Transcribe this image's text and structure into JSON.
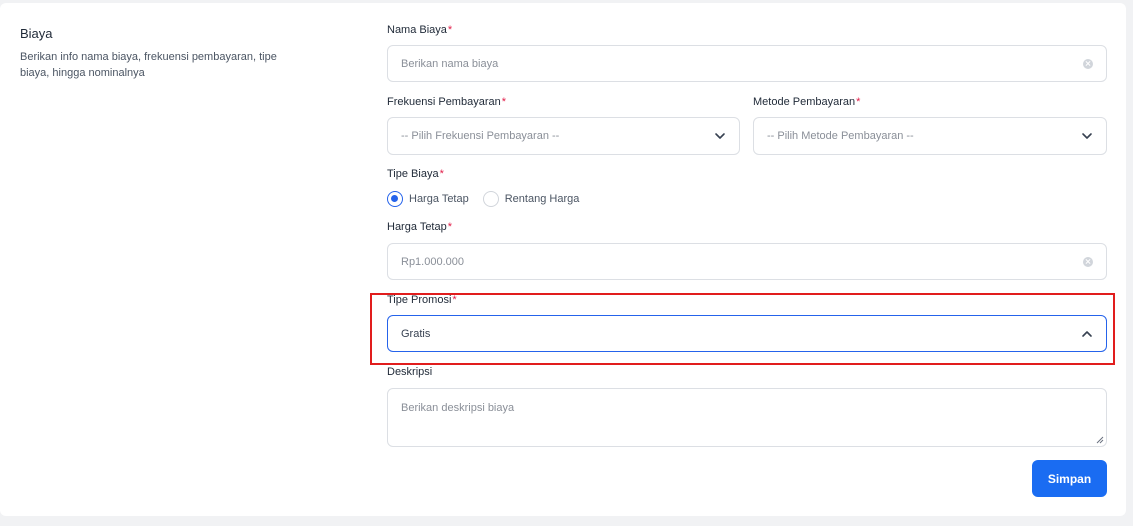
{
  "section": {
    "title": "Biaya",
    "description": "Berikan info nama biaya, frekuensi pembayaran, tipe biaya, hingga nominalnya"
  },
  "form": {
    "required_mark": "*",
    "nama_biaya": {
      "label": "Nama Biaya",
      "placeholder": "Berikan nama biaya"
    },
    "frekuensi": {
      "label": "Frekuensi Pembayaran",
      "value": "-- Pilih Frekuensi Pembayaran --"
    },
    "metode": {
      "label": "Metode Pembayaran",
      "value": "-- Pilih Metode Pembayaran --"
    },
    "tipe_biaya": {
      "label": "Tipe Biaya",
      "options": [
        "Harga Tetap",
        "Rentang Harga"
      ],
      "selected": "Harga Tetap"
    },
    "harga_tetap": {
      "label": "Harga Tetap",
      "placeholder": "Rp1.000.000"
    },
    "tipe_promosi": {
      "label": "Tipe Promosi",
      "value": "Gratis"
    },
    "deskripsi": {
      "label": "Deskripsi",
      "placeholder": "Berikan deskripsi biaya"
    },
    "submit_label": "Simpan"
  },
  "icons": {
    "clear": "clear-circle-icon",
    "dropdown_closed": "chevron-down-icon",
    "dropdown_open": "chevron-up-icon"
  },
  "colors": {
    "primary": "#1a6cf2",
    "required": "#e11d48",
    "annotation": "#e11d1d"
  }
}
